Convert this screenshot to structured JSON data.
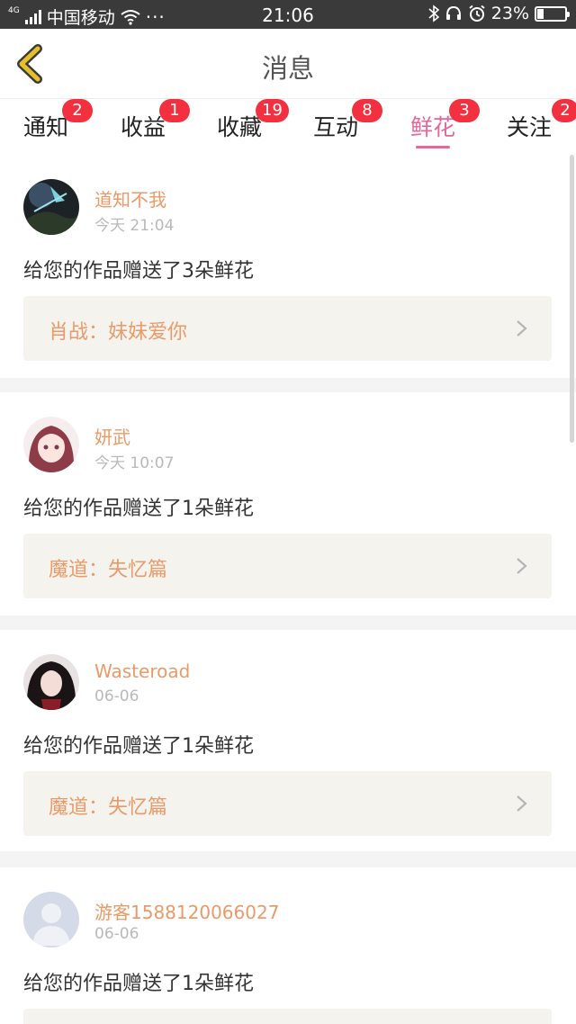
{
  "status_bar": {
    "network": "4G",
    "carrier": "中国移动",
    "dots": "···",
    "time": "21:06",
    "battery": "23%",
    "battery_level": 0.23,
    "icons": [
      "signal-icon",
      "wifi-icon",
      "bluetooth-icon",
      "headset-icon",
      "alarm-icon",
      "battery-icon"
    ]
  },
  "header": {
    "title": "消息",
    "back_icon": "chevron-left-icon",
    "accent": "#e5c02a"
  },
  "tabs": [
    {
      "label": "通知",
      "badge": "2"
    },
    {
      "label": "收益",
      "badge": "1"
    },
    {
      "label": "收藏",
      "badge": "19"
    },
    {
      "label": "互动",
      "badge": "8"
    },
    {
      "label": "鲜花",
      "badge": "3",
      "active": true
    },
    {
      "label": "关注",
      "badge": "2"
    }
  ],
  "colors": {
    "active_tab": "#e5669a",
    "badge": "#f3303f",
    "username": "#ea9a68",
    "link_bg": "#f4f3ee"
  },
  "feed": [
    {
      "user": "道知不我",
      "time": "今天 21:04",
      "message": "给您的作品赠送了3朵鲜花",
      "work": "肖战：妹妹爱你",
      "avatar": "avatar-dark-scene"
    },
    {
      "user": "妍武",
      "time": "今天 10:07",
      "message": "给您的作品赠送了1朵鲜花",
      "work": "魔道：失忆篇",
      "avatar": "avatar-anime-girl"
    },
    {
      "user": "Wasteroad",
      "time": "06-06",
      "message": "给您的作品赠送了1朵鲜花",
      "work": "魔道：失忆篇",
      "avatar": "avatar-dark-hair"
    },
    {
      "user": "游客1588120066027",
      "time": "06-06",
      "message": "给您的作品赠送了1朵鲜花",
      "work": "",
      "avatar": "avatar-default"
    }
  ]
}
